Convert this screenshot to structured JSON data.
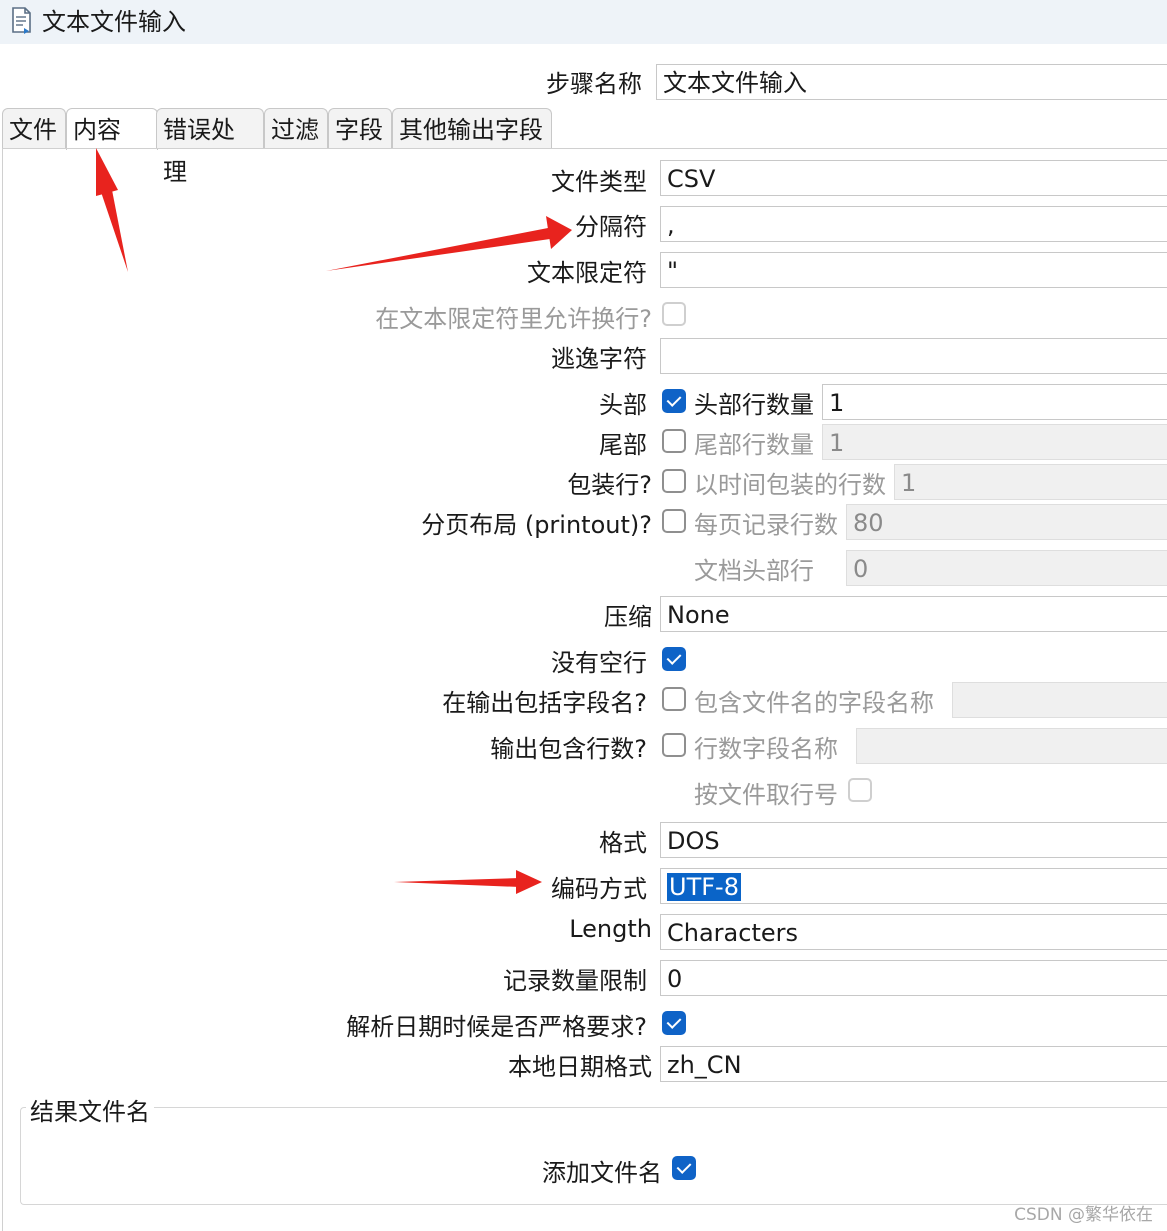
{
  "window": {
    "title": "文本文件输入",
    "icon": "text-file-icon"
  },
  "step_name": {
    "label": "步骤名称",
    "value": "文本文件输入"
  },
  "tabs": [
    {
      "label": "文件"
    },
    {
      "label": "内容"
    },
    {
      "label": "错误处理"
    },
    {
      "label": "过滤"
    },
    {
      "label": "字段"
    },
    {
      "label": "其他输出字段"
    }
  ],
  "content": {
    "file_type": {
      "label": "文件类型",
      "value": "CSV"
    },
    "separator": {
      "label": "分隔符",
      "value": ","
    },
    "enclosure": {
      "label": "文本限定符",
      "value": "\""
    },
    "allow_breaks": {
      "label": "在文本限定符里允许换行?",
      "checked": false
    },
    "escape": {
      "label": "逃逸字符",
      "value": ""
    },
    "header": {
      "label": "头部",
      "checked": true,
      "rows_label": "头部行数量",
      "rows_value": "1"
    },
    "footer": {
      "label": "尾部",
      "checked": false,
      "rows_label": "尾部行数量",
      "rows_value": "1"
    },
    "wrap": {
      "label": "包装行?",
      "checked": false,
      "rows_label": "以时间包装的行数",
      "rows_value": "1"
    },
    "layout": {
      "label": "分页布局 (printout)?",
      "checked": false,
      "per_page_label": "每页记录行数",
      "per_page_value": "80",
      "doc_header_label": "文档头部行",
      "doc_header_value": "0"
    },
    "compression": {
      "label": "压缩",
      "value": "None"
    },
    "no_empty_rows": {
      "label": "没有空行",
      "checked": true
    },
    "include_filename": {
      "label": "在输出包括字段名?",
      "checked": false,
      "field_label": "包含文件名的字段名称",
      "field_value": ""
    },
    "include_rownum": {
      "label": "输出包含行数?",
      "checked": false,
      "field_label": "行数字段名称",
      "field_value": ""
    },
    "rownum_by_file": {
      "label": "按文件取行号",
      "checked": false
    },
    "format": {
      "label": "格式",
      "value": "DOS"
    },
    "encoding": {
      "label": "编码方式",
      "value": "UTF-8"
    },
    "length": {
      "label": "Length",
      "value": "Characters"
    },
    "limit": {
      "label": "记录数量限制",
      "value": "0"
    },
    "strict_dates": {
      "label": "解析日期时候是否严格要求?",
      "checked": true
    },
    "locale": {
      "label": "本地日期格式",
      "value": "zh_CN"
    }
  },
  "result_group": {
    "title": "结果文件名",
    "add_filename_label": "添加文件名",
    "add_filename_checked": true
  },
  "watermark": "CSDN @繁华依在",
  "colors": {
    "accent": "#0f63c7",
    "annotation": "#e8231e"
  }
}
